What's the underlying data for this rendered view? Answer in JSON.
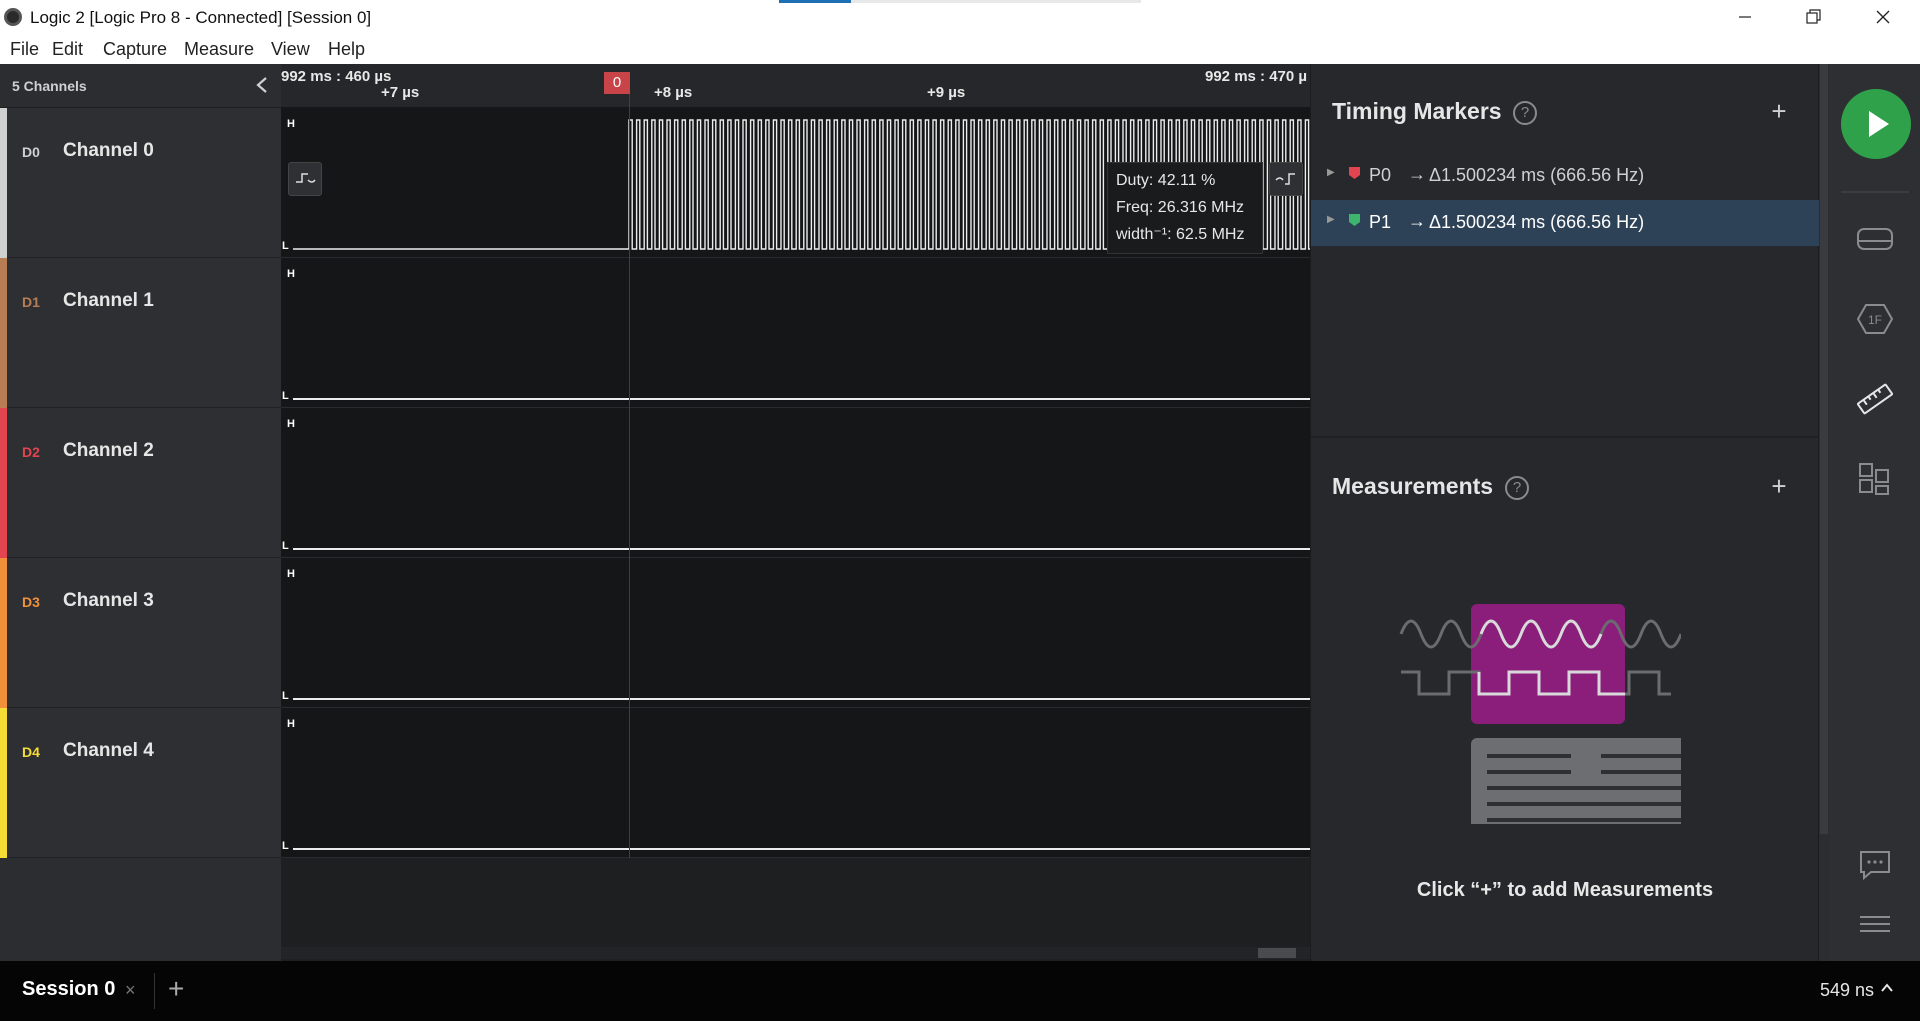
{
  "window": {
    "title": "Logic 2 [Logic Pro 8 - Connected] [Session 0]",
    "min_label": "—",
    "max_label": "❐",
    "close_label": "✕"
  },
  "menu": {
    "items": [
      {
        "label": "File"
      },
      {
        "label": "Edit"
      },
      {
        "label": "Capture"
      },
      {
        "label": "Measure"
      },
      {
        "label": "View"
      },
      {
        "label": "Help"
      }
    ]
  },
  "channels": {
    "count_label": "5 Channels",
    "items": [
      {
        "dlabel": "D0",
        "name": "Channel 0",
        "color": "#d0d0d0"
      },
      {
        "dlabel": "D1",
        "name": "Channel 1",
        "color": "#b87d54"
      },
      {
        "dlabel": "D2",
        "name": "Channel 2",
        "color": "#e2454f"
      },
      {
        "dlabel": "D3",
        "name": "Channel 3",
        "color": "#f0913a"
      },
      {
        "dlabel": "D4",
        "name": "Channel 4",
        "color": "#f6dd35"
      }
    ]
  },
  "ruler": {
    "left_label": "992 ms : 460 µs",
    "right_label": "992 ms : 470 µ",
    "ticks": [
      "+7 µs",
      "+8 µs",
      "+9 µs"
    ],
    "marker": "0"
  },
  "lanes": {
    "high": "H",
    "low": "L"
  },
  "tooltip": {
    "duty": "Duty: 42.11 %",
    "freq": "Freq: 26.316 MHz",
    "width": "width⁻¹: 62.5 MHz"
  },
  "timing_markers": {
    "title": "Timing Markers",
    "help": "?",
    "add": "+",
    "rows": [
      {
        "name": "P0",
        "arrow": "→",
        "value": "Δ1.500234 ms (666.56 Hz)",
        "flag_color": "#e2454f"
      },
      {
        "name": "P1",
        "arrow": "→",
        "value": "Δ1.500234 ms (666.56 Hz)",
        "flag_color": "#3eb46c"
      }
    ]
  },
  "measurements": {
    "title": "Measurements",
    "help": "?",
    "add": "+",
    "empty_message": "Click “+” to add Measurements"
  },
  "bottom": {
    "session_tab": "Session 0",
    "close": "×",
    "add": "+",
    "timestamp": "549 ns",
    "caret": "^"
  }
}
